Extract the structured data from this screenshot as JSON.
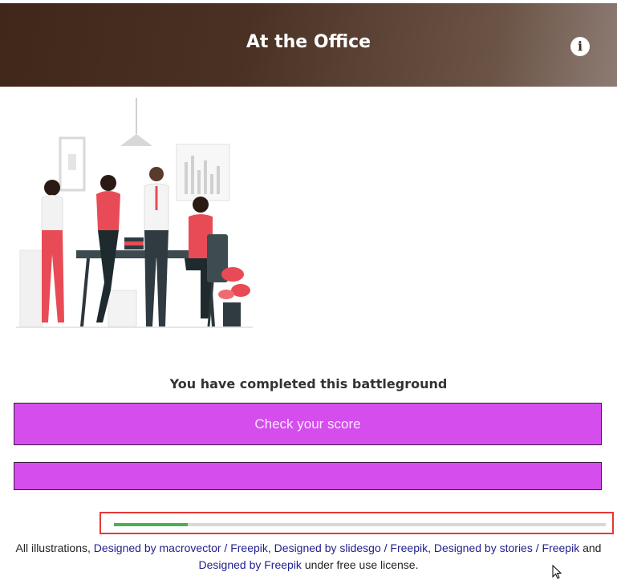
{
  "header": {
    "title": "At the Office",
    "info_icon": "info-icon"
  },
  "main": {
    "illustration_icon": "office-team-illustration",
    "completion_message": "You have completed this battleground",
    "check_score_label": "Check your score",
    "second_button_label": ""
  },
  "progress": {
    "value": 0.15
  },
  "footer": {
    "text1": "All illustrations, ",
    "link1": "Designed by macrovector / Freepik",
    "sep1": ", ",
    "link2": "Designed by slidesgo / Freepik",
    "sep2": ", ",
    "link3": "Designed by stories / Freepik",
    "sep3": " and",
    "link4": "Designed by Freepik",
    "text2": " under free use license."
  },
  "colors": {
    "accent": "#d54ded",
    "progress": "#4caf50",
    "header_dark": "#40271a"
  }
}
